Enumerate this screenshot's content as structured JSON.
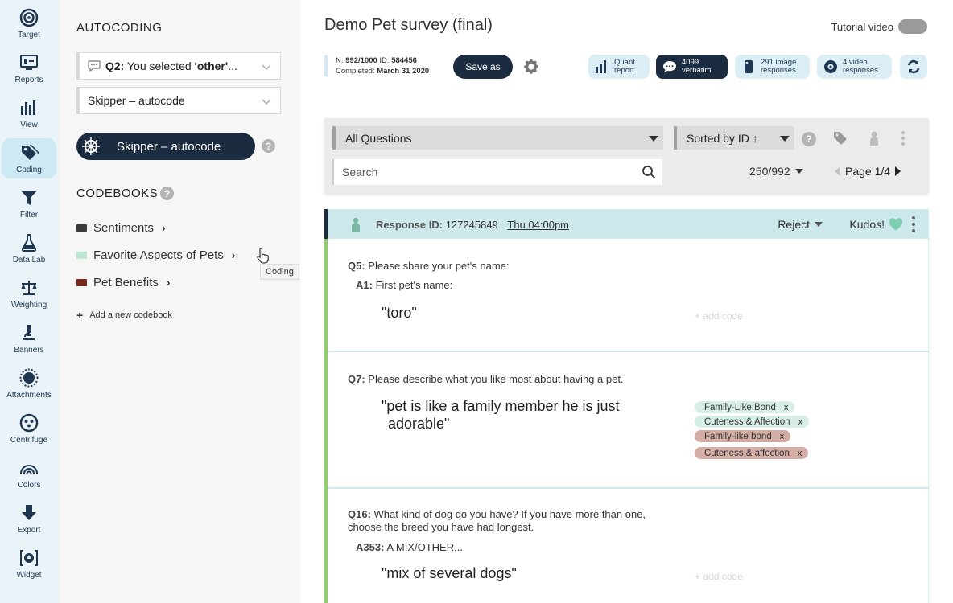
{
  "rail": {
    "items": [
      {
        "label": "Target",
        "icon": "target-icon"
      },
      {
        "label": "Reports",
        "icon": "reports-icon"
      },
      {
        "label": "View",
        "icon": "bar-chart-icon"
      },
      {
        "label": "Coding",
        "icon": "tag-icon",
        "active": true
      },
      {
        "label": "Filter",
        "icon": "filter-icon"
      },
      {
        "label": "Data Lab",
        "icon": "flask-icon"
      },
      {
        "label": "Weighting",
        "icon": "scale-icon"
      },
      {
        "label": "Banners",
        "icon": "microscope-icon"
      },
      {
        "label": "Attachments",
        "icon": "sun-icon"
      },
      {
        "label": "Centrifuge",
        "icon": "centrifuge-icon"
      },
      {
        "label": "Colors",
        "icon": "rainbow-icon"
      },
      {
        "label": "Export",
        "icon": "download-arrow-icon"
      },
      {
        "label": "Widget",
        "icon": "widget-icon"
      }
    ]
  },
  "panel": {
    "title": "AUTOCODING",
    "question_select_prefix": "Q2:",
    "question_select_mid": " You selected ",
    "question_select_bold": "'other'",
    "question_select_suffix": "...",
    "autocode_select": "Skipper – autocode",
    "skipper_button": "Skipper – autocode",
    "help": "?",
    "codebooks_title": "CODEBOOKS",
    "codebooks": [
      {
        "label": "Sentiments",
        "color": "#3b3b3b"
      },
      {
        "label": "Favorite Aspects of Pets",
        "color": "#bfe8d3"
      },
      {
        "label": "Pet Benefits",
        "color": "#7a2a1e"
      }
    ],
    "add_codebook": "Add a new codebook",
    "tooltip": "Coding"
  },
  "main": {
    "survey_title": "Demo Pet survey (final)",
    "tutorial": "Tutorial video",
    "meta": {
      "n_label": "N:",
      "n_value": "992/1000",
      "id_label": "ID:",
      "id_value": "584456",
      "completed_label": "Completed:",
      "completed_value": "March 31 2020"
    },
    "save_as": "Save as",
    "pills": [
      {
        "line1": "Quant",
        "line2": "report",
        "icon": "bar-chart-icon"
      },
      {
        "line1": "4099",
        "line2": "verbatim",
        "icon": "speech-bubble-icon",
        "dark": true
      },
      {
        "line1": "291 image",
        "line2": "responses",
        "icon": "image-icon"
      },
      {
        "line1": "4 video",
        "line2": "responses",
        "icon": "video-icon"
      }
    ],
    "filter": {
      "questions": "All Questions",
      "sort": "Sorted by ID ↑",
      "search_placeholder": "Search",
      "count": "250/992",
      "page": "Page 1/4"
    },
    "response": {
      "id_label": "Response ID:",
      "id_value": "127245849",
      "time": "Thu 04:00pm",
      "reject": "Reject",
      "kudos": "Kudos!",
      "heart_color": "#7ccfb0"
    },
    "questions": [
      {
        "q_label": "Q5:",
        "q_text": "Please share your pet's name:",
        "a_label": "A1:",
        "a_text": "First pet's name:",
        "answer": "\"toro\"",
        "add_code": "+ add code"
      },
      {
        "q_label": "Q7:",
        "q_text": "Please describe what you like most about having a pet.",
        "answer_line1": "\"pet is like a family member he is just",
        "answer_line2": "adorable\"",
        "tags": [
          {
            "label": "Family-Like Bond",
            "style": "green"
          },
          {
            "label": "Cuteness & Affection",
            "style": "green"
          },
          {
            "label": "Family-like bond",
            "style": "brown"
          },
          {
            "label": "Cuteness & affection",
            "style": "brown"
          }
        ],
        "tag_remove": "x"
      },
      {
        "q_label": "Q16:",
        "q_line1": "What kind of dog do you have? If you have more than one,",
        "q_line2": "choose the breed you have had longest.",
        "a_label": "A353:",
        "a_text": "A MIX/OTHER...",
        "answer": "\"mix of several dogs\"",
        "add_code": "+ add code"
      }
    ]
  }
}
